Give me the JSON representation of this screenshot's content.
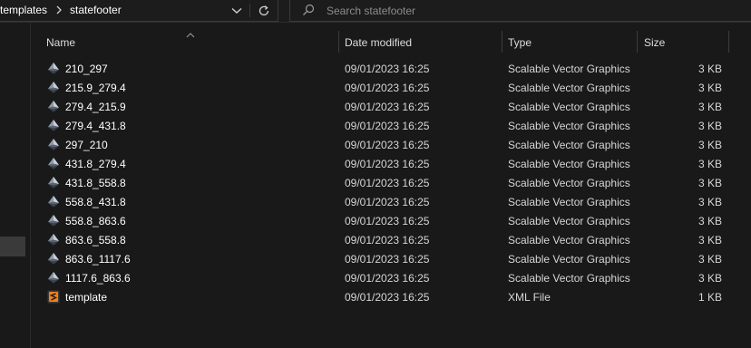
{
  "breadcrumb": {
    "items": [
      "templates",
      "statefooter"
    ]
  },
  "search": {
    "placeholder": "Search statefooter"
  },
  "columns": {
    "name": "Name",
    "date": "Date modified",
    "type": "Type",
    "size": "Size"
  },
  "files": [
    {
      "name": "210_297",
      "date": "09/01/2023 16:25",
      "type": "Scalable Vector Graphics",
      "size": "3 KB",
      "icon": "svg-file-icon"
    },
    {
      "name": "215.9_279.4",
      "date": "09/01/2023 16:25",
      "type": "Scalable Vector Graphics",
      "size": "3 KB",
      "icon": "svg-file-icon"
    },
    {
      "name": "279.4_215.9",
      "date": "09/01/2023 16:25",
      "type": "Scalable Vector Graphics",
      "size": "3 KB",
      "icon": "svg-file-icon"
    },
    {
      "name": "279.4_431.8",
      "date": "09/01/2023 16:25",
      "type": "Scalable Vector Graphics",
      "size": "3 KB",
      "icon": "svg-file-icon"
    },
    {
      "name": "297_210",
      "date": "09/01/2023 16:25",
      "type": "Scalable Vector Graphics",
      "size": "3 KB",
      "icon": "svg-file-icon"
    },
    {
      "name": "431.8_279.4",
      "date": "09/01/2023 16:25",
      "type": "Scalable Vector Graphics",
      "size": "3 KB",
      "icon": "svg-file-icon"
    },
    {
      "name": "431.8_558.8",
      "date": "09/01/2023 16:25",
      "type": "Scalable Vector Graphics",
      "size": "3 KB",
      "icon": "svg-file-icon"
    },
    {
      "name": "558.8_431.8",
      "date": "09/01/2023 16:25",
      "type": "Scalable Vector Graphics",
      "size": "3 KB",
      "icon": "svg-file-icon"
    },
    {
      "name": "558.8_863.6",
      "date": "09/01/2023 16:25",
      "type": "Scalable Vector Graphics",
      "size": "3 KB",
      "icon": "svg-file-icon"
    },
    {
      "name": "863.6_558.8",
      "date": "09/01/2023 16:25",
      "type": "Scalable Vector Graphics",
      "size": "3 KB",
      "icon": "svg-file-icon"
    },
    {
      "name": "863.6_1117.6",
      "date": "09/01/2023 16:25",
      "type": "Scalable Vector Graphics",
      "size": "3 KB",
      "icon": "svg-file-icon"
    },
    {
      "name": "1117.6_863.6",
      "date": "09/01/2023 16:25",
      "type": "Scalable Vector Graphics",
      "size": "3 KB",
      "icon": "svg-file-icon"
    },
    {
      "name": "template",
      "date": "09/01/2023 16:25",
      "type": "XML File",
      "size": "1 KB",
      "icon": "sublime-text-file-icon"
    }
  ],
  "colors": {
    "background": "#191919",
    "svg_icon": "#9aa4b2",
    "xml_icon": "#f4801a"
  }
}
